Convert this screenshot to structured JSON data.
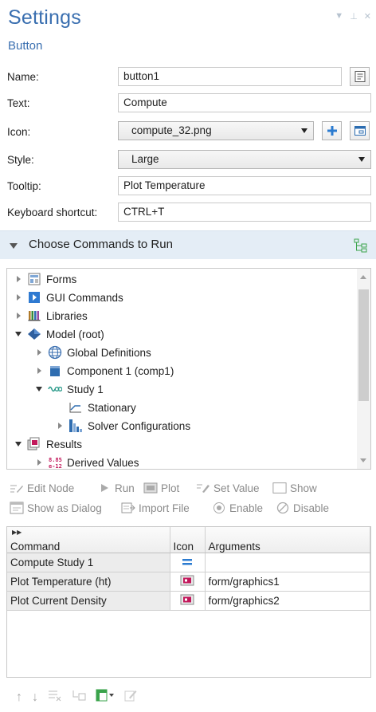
{
  "header": {
    "title": "Settings",
    "subtitle": "Button"
  },
  "form": {
    "name_label": "Name:",
    "name_value": "button1",
    "text_label": "Text:",
    "text_value": "Compute",
    "icon_label": "Icon:",
    "icon_value": "compute_32.png",
    "style_label": "Style:",
    "style_value": "Large",
    "tooltip_label": "Tooltip:",
    "tooltip_value": "Plot Temperature",
    "shortcut_label": "Keyboard shortcut:",
    "shortcut_value": "CTRL+T"
  },
  "section": {
    "title": "Choose Commands to Run"
  },
  "tree": {
    "forms": "Forms",
    "gui_commands": "GUI Commands",
    "libraries": "Libraries",
    "model_root": "Model (root)",
    "global_definitions": "Global Definitions",
    "component": "Component 1 (comp1)",
    "study": "Study 1",
    "stationary": "Stationary",
    "solver_configurations": "Solver Configurations",
    "results": "Results",
    "derived_values": "Derived Values",
    "derived_values_icon_text": "8.85\ne-12"
  },
  "toolbar": {
    "edit_node": "Edit Node",
    "run": "Run",
    "plot": "Plot",
    "set_value": "Set Value",
    "show": "Show",
    "show_as_dialog": "Show as Dialog",
    "import_file": "Import File",
    "enable": "Enable",
    "disable": "Disable"
  },
  "table": {
    "headers": {
      "command": "Command",
      "icon": "Icon",
      "arguments": "Arguments"
    },
    "rows": [
      {
        "command": "Compute Study 1",
        "icon": "compute-icon",
        "arguments": ""
      },
      {
        "command": "Plot Temperature (ht)",
        "icon": "plot-icon",
        "arguments": "form/graphics1"
      },
      {
        "command": "Plot Current Density",
        "icon": "plot-icon",
        "arguments": "form/graphics2"
      }
    ]
  },
  "colors": {
    "accent": "#3a6fb0",
    "section_bg": "#e4edf6",
    "green_icon": "#3aa34b"
  }
}
